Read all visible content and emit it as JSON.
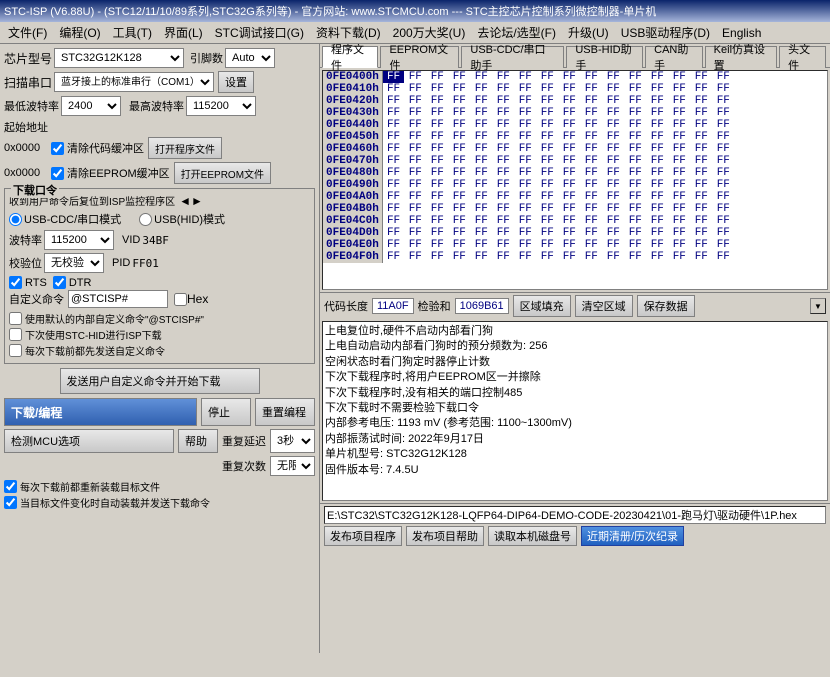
{
  "title": {
    "text": "STC-ISP (V6.88U) - (STC12/11/10/89系列,STC32G系列等) - 官方网站: www.STCMCU.com --- STC主控芯片控制系列微控制器-单片机",
    "lang_menu": "English"
  },
  "menu": {
    "items": [
      "文件(F)",
      "编程(O)",
      "工具(T)",
      "界面(L)",
      "STC调试接口(G)",
      "资料下载(D)",
      "200万大奖(U)",
      "去论坛/选型(F)",
      "升级(U)",
      "USB驱动程序(D)",
      "English"
    ]
  },
  "right_tabs": {
    "tabs": [
      "程序文件",
      "EEPROM文件",
      "USB-CDC/串口助手",
      "USB-HID助手",
      "CAN助手",
      "Keil仿真设置",
      "头文件"
    ]
  },
  "left": {
    "chip_label": "芯片型号",
    "chip_value": "STC32G12K128",
    "引脚数_label": "引脚数",
    "引脚数_value": "Auto",
    "扫描串口_label": "扫描串口",
    "扫描串口_value": "蓝牙接上的标准串行（COM1）",
    "设置_btn": "设置",
    "最低波特率_label": "最低波特率",
    "最低波特率_value": "2400",
    "最高波特率_label": "最高波特率",
    "最高波特率_value": "115200",
    "起始地址_label": "起始地址",
    "addr1_label": "0x0000",
    "清除代码缓冲区": "清除代码缓冲区",
    "打开程序文件": "打开程序文件",
    "addr2_label": "0x0000",
    "清除EEPROM缓冲区": "清除EEPROM缓冲区",
    "打开EEPROM文件": "打开EEPROM文件",
    "下载口令_label": "下载口令",
    "收到用户命令后复位到ISP监控程序区": "收到用户命令后复位到ISP监控程序区",
    "usb_cdc_label": "USB-CDC/串口模式",
    "usb_hid_label": "USB(HID)模式",
    "波特率_label": "波特率",
    "波特率_value": "115200",
    "vid_label": "VID",
    "vid_value": "34BF",
    "校验位_label": "校验位",
    "校验位_value": "无校验",
    "pid_label": "PID",
    "pid_value": "FF01",
    "rts_label": "RTS",
    "dtr_label": "DTR",
    "自定义命令_label": "自定义命令",
    "自定义命令_value": "@STCISP#",
    "hex_label": "Hex",
    "使用默认": "使用默认的内部自定义命令\"@STCISP#\"",
    "下次使用STC-HID": "下次使用STC-HID进行ISP下载",
    "每次下载前先发送": "每次下载前都先发送自定义命令",
    "发送用户": "发送用户自定义命令并开始下载",
    "下载编程": "下载/编程",
    "停止": "停止",
    "重置编程": "重置编程",
    "检测MCU选项": "检测MCU选项",
    "帮助": "帮助",
    "重复延迟_label": "重复延迟",
    "重复延迟_value": "3秒",
    "重复次数_label": "重复次数",
    "重复次数_value": "无限",
    "每次下载重新装载目标文件": "每次下载前都重新装载目标文件",
    "当目标文件变化时自动装载并发送下载命令": "当目标文件变化时自动装载并发送下载命令"
  },
  "hex_table": {
    "addresses": [
      "0FE0400h",
      "0FE0410h",
      "0FE0420h",
      "0FE0430h",
      "0FE0440h",
      "0FE0450h",
      "0FE0460h",
      "0FE0470h",
      "0FE0480h",
      "0FE0490h",
      "0FE04A0h",
      "0FE04B0h",
      "0FE04C0h",
      "0FE04D0h",
      "0FE04E0h",
      "0FE04F0h"
    ],
    "selected_addr": "0FE0400h",
    "selected_val": "FF",
    "code_length_label": "代码长度",
    "code_length_value": "11A0F",
    "checksum_label": "检验和",
    "checksum_value": "1069B61",
    "fill_btn": "区域填充",
    "clear_btn": "清空区域",
    "save_btn": "保存数据"
  },
  "log": {
    "lines": [
      "上电复位时,硬件不启动内部看门狗",
      "上电自动启动内部看门狗时的预分频数为: 256",
      "空闲状态时看门狗定时器停止计数",
      "下次下载程序时,将用户EEPROM区一并擦除",
      "下次下载程序时,没有相关的端口控制485",
      "下次下载时不需要检验下载口令",
      "内部参考电压: 1193 mV (参考范围: 1100~1300mV)",
      "内部振荡试时间: 2022年9月17日",
      "",
      "单片机型号: STC32G12K128",
      "固件版本号: 7.4.5U"
    ]
  },
  "bottom": {
    "path_value": "E:\\STC32\\STC32G12K128-LQFP64-DIP64-DEMO-CODE-20230421\\01-跑马灯\\驱动硬件\\1P.hex",
    "publish_btn": "发布项目程序",
    "publish_help_btn": "发布项目帮助",
    "read_machine_btn": "读取本机磁盘号",
    "format_btn": "近期清册/历次纪录"
  }
}
